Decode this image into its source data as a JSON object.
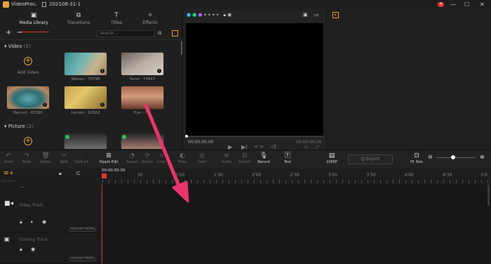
{
  "titlebar": {
    "app": "VideoProc",
    "project": "202108-31-1",
    "notif": "4"
  },
  "tabs": [
    {
      "label": "Media Library",
      "icon": "film"
    },
    {
      "label": "Transitions",
      "icon": "transition"
    },
    {
      "label": "Titles",
      "icon": "T"
    },
    {
      "label": "Effects",
      "icon": "sparkle"
    }
  ],
  "library": {
    "search_placeholder": "Search...",
    "video_label": "Video",
    "video_count": "(5)",
    "picture_label": "Picture",
    "picture_count": "(2)",
    "add_video": "Add Video",
    "clips": [
      {
        "name": "Waves - 70796"
      },
      {
        "name": "Sand - 73847"
      },
      {
        "name": "Record - 65390"
      },
      {
        "name": "Lemon - 82602"
      },
      {
        "name": "Eye - 7..."
      }
    ]
  },
  "preview": {
    "time_start": "00:00:00.00",
    "time_end": "00:00:00.00"
  },
  "toolbar": {
    "undo": "Undo",
    "redo": "Redo",
    "delete": "Delete",
    "split": "Split",
    "split_all": "Split all",
    "ripple": "Ripple Edit",
    "speed": "Speed",
    "rotate": "Rotate",
    "crop": "Crop",
    "filter": "Filter",
    "color": "Color",
    "audio": "Audio",
    "detach": "Detach",
    "record": "Record",
    "text": "Text",
    "res": "1080P",
    "export": "Export",
    "fit": "Fit Size"
  },
  "timeline": {
    "current": "00:00:00.00",
    "ticks": [
      "30",
      "1'00",
      "1'30",
      "2'00",
      "2'30",
      "3'00",
      "3'30",
      "4'00",
      "4'30",
      "5'0"
    ],
    "duration_label": "Duration:",
    "video_track": "Video Track",
    "overlay_track": "Overlay Track",
    "opacity": "Opacity: 100%",
    "volume": "Volume: 100%"
  },
  "colors": {
    "accent": "#e8a33a",
    "playhead": "#e53935",
    "annotation_arrow": "#e8356b"
  }
}
